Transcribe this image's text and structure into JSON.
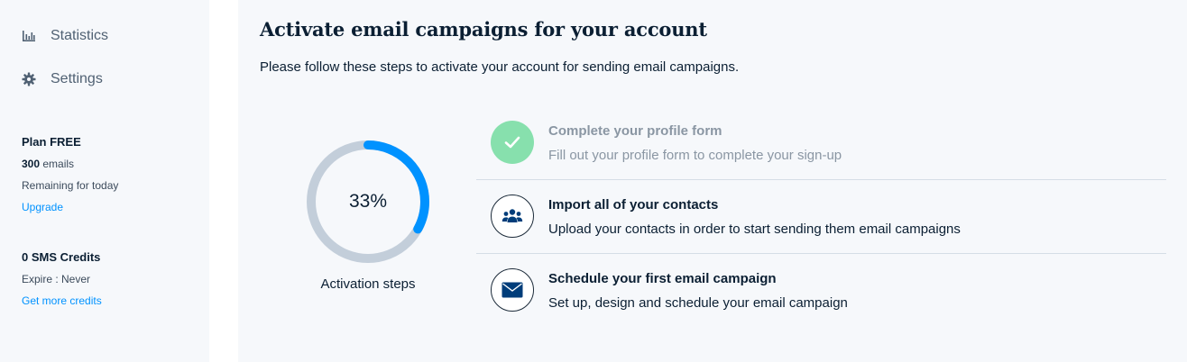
{
  "sidebar": {
    "nav": [
      {
        "label": "Statistics",
        "icon": "bar-chart-icon"
      },
      {
        "label": "Settings",
        "icon": "gear-icon"
      }
    ],
    "plan": {
      "title": "Plan FREE",
      "emails_count": "300",
      "emails_suffix": " emails",
      "remaining": "Remaining for today",
      "upgrade": "Upgrade"
    },
    "sms": {
      "title": "0 SMS Credits",
      "expire": "Expire : Never",
      "more": "Get more credits"
    }
  },
  "main": {
    "title": "Activate email campaigns for your account",
    "subtitle": "Please follow these steps to activate your account for sending email campaigns.",
    "progress": {
      "percent_label": "33%",
      "value": 0.33,
      "label": "Activation steps"
    },
    "steps": [
      {
        "title": "Complete your profile form",
        "desc": "Fill out your profile form to complete your sign-up",
        "done": true,
        "icon": "check-icon"
      },
      {
        "title": "Import all of your contacts",
        "desc": "Upload your contacts in order to start sending them email campaigns",
        "done": false,
        "icon": "contacts-icon"
      },
      {
        "title": "Schedule your first email campaign",
        "desc": "Set up, design and schedule your email campaign",
        "done": false,
        "icon": "envelope-icon"
      }
    ]
  },
  "colors": {
    "accent": "#0092ff",
    "track": "#c3ceda",
    "done": "#87e0ad",
    "icon_dark": "#003d7a"
  }
}
